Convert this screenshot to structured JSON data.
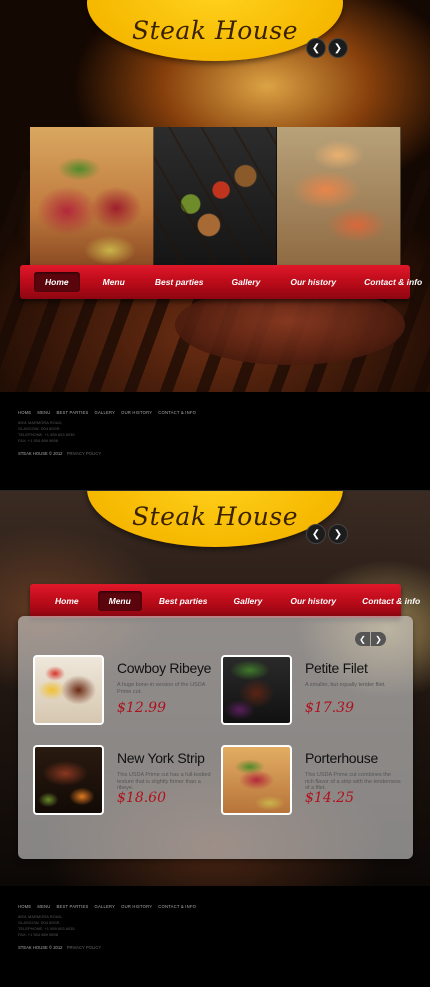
{
  "site": {
    "logo_text": "Steak House"
  },
  "nav": {
    "items": [
      "Home",
      "Menu",
      "Best parties",
      "Gallery",
      "Our history",
      "Contact  & info"
    ]
  },
  "screen1": {
    "active_nav": "Home",
    "slider": {
      "slides": [
        "raw steak with herbs",
        "grilled vegetable skewers",
        "grilled shrimp"
      ]
    }
  },
  "screen2": {
    "active_nav": "Menu",
    "products": [
      {
        "title": "Cowboy Ribeye",
        "description": "A huge bone-in version of the USDA Prime cut.",
        "price": "$12.99"
      },
      {
        "title": "Petite Filet",
        "description": "A smaller, but equally tender filet.",
        "price": "$17.39"
      },
      {
        "title": "New York Strip",
        "description": "This USDA Prime cut has a full-bodied texture that is slightly firmer than a ribeye.",
        "price": "$18.60"
      },
      {
        "title": "Porterhouse",
        "description": "This USDA Prime cut combines the rich flavor of a strip with the tenderness of a filet.",
        "price": "$14.25"
      }
    ]
  },
  "footer": {
    "links": [
      "HOME",
      "MENU",
      "BEST PARTIES",
      "GALLERY",
      "OUR HISTORY",
      "CONTACT & INFO"
    ],
    "address_lines": [
      "8901 MARMORA ROAD,",
      "GLASGOW, D04 89GR.",
      "TELEPHONE: +1 959 603 6035",
      "FAX: +1 504 889 9898"
    ],
    "copyright": "STEAK HOUSE  © 2012",
    "privacy": "PRIVACY POLICY"
  },
  "colors": {
    "accent_red": "#c10f1e",
    "logo_yellow": "#f6b800",
    "price_red": "#b0101c"
  }
}
